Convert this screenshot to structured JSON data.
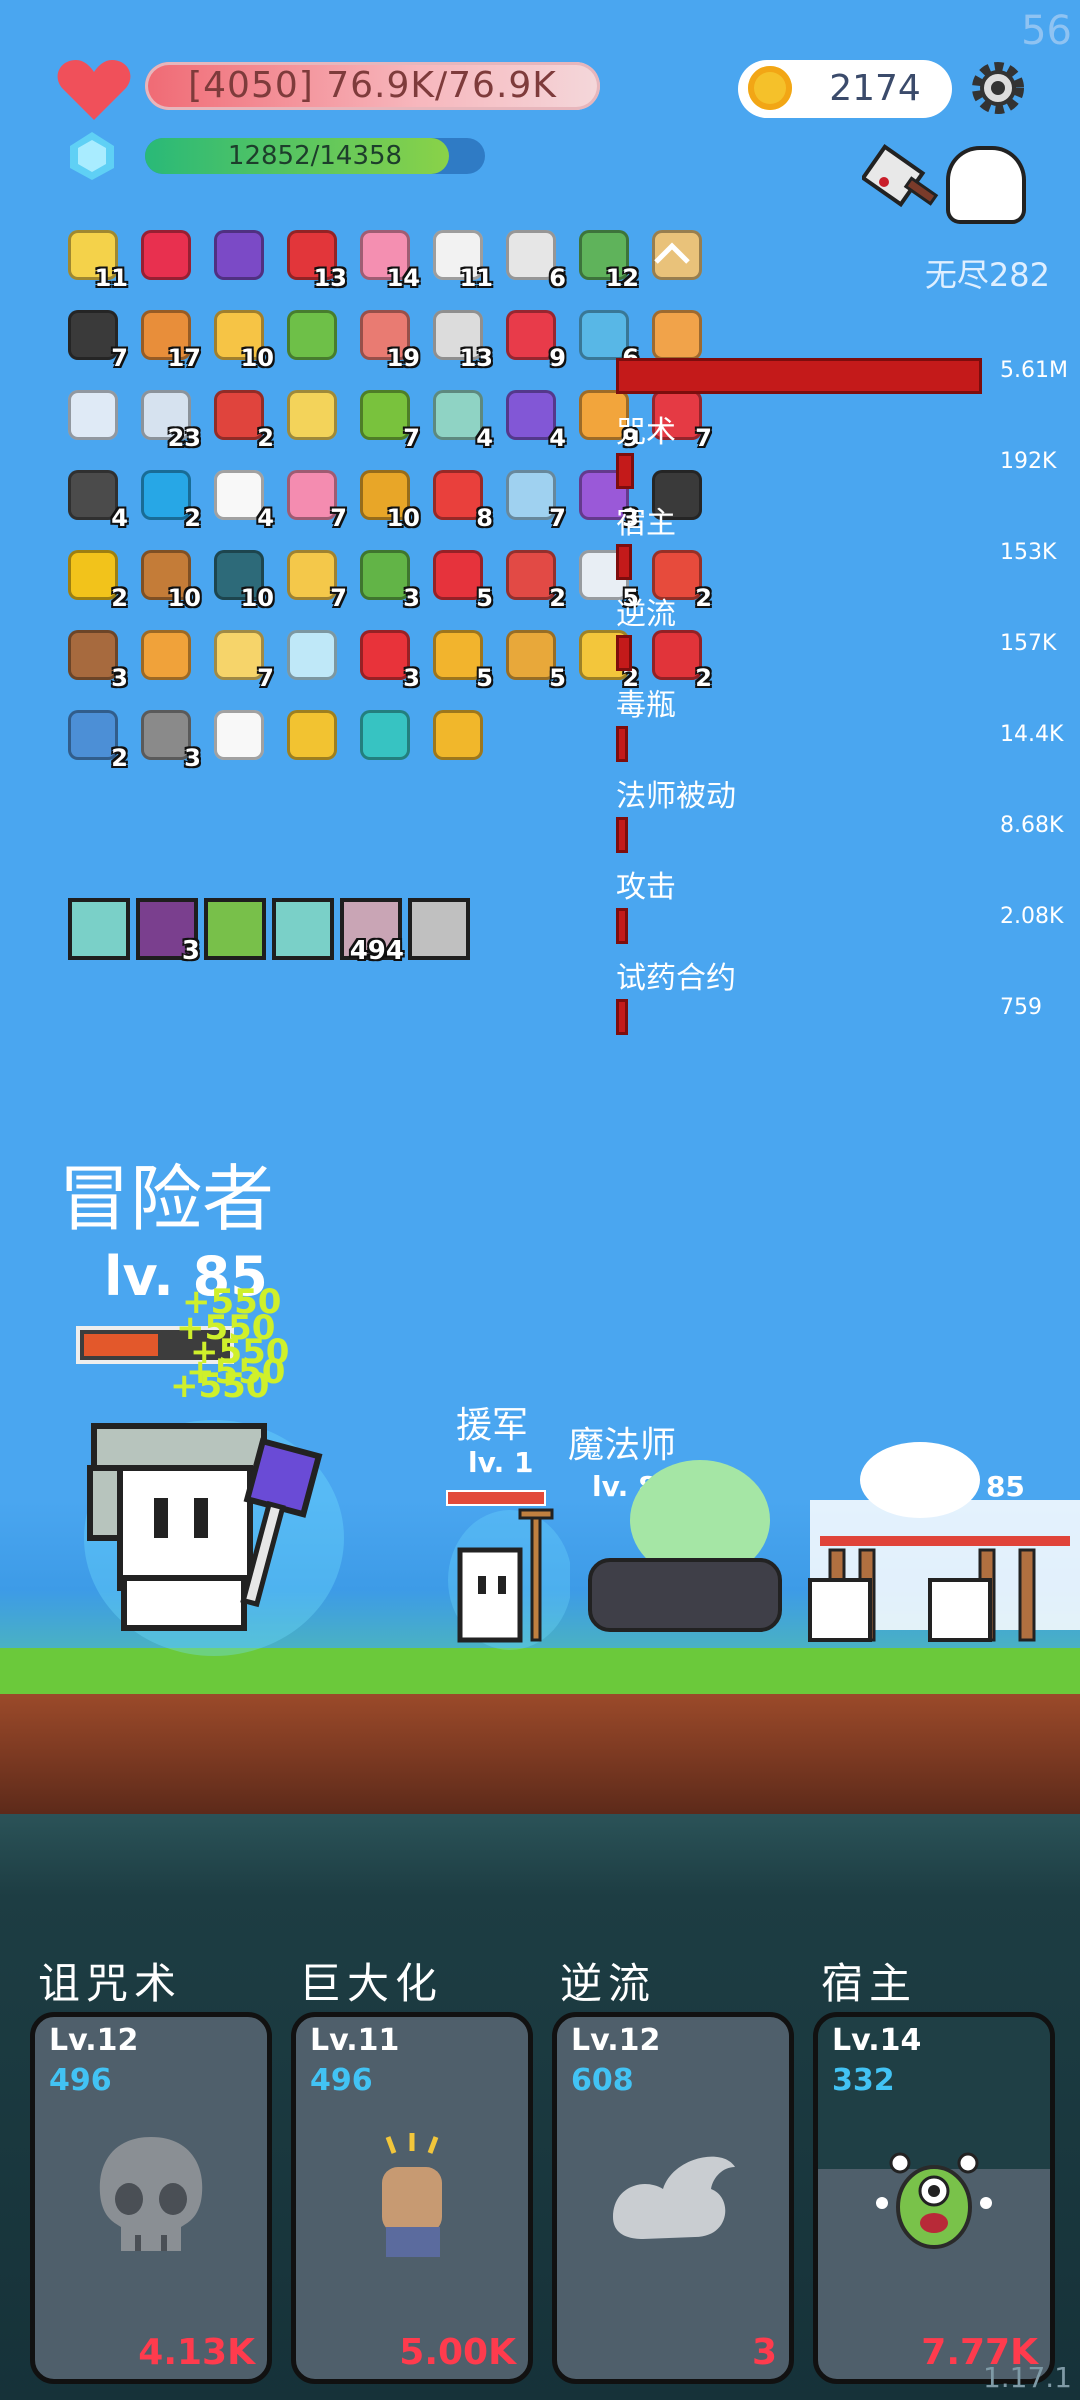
{
  "hud": {
    "fps": "56",
    "hp_text": "[4050] 76.9K/76.9K",
    "xp_text": "12852/14358",
    "xp_fraction": 0.8951,
    "coins": "2174",
    "endless_label": "无尽282"
  },
  "items": [
    {
      "icon": "star-card-icon",
      "color": "#f4d24a",
      "count": "11"
    },
    {
      "icon": "ruby-icon",
      "color": "#e8304f",
      "count": ""
    },
    {
      "icon": "wizard-hat-icon",
      "color": "#7b4ac6",
      "count": ""
    },
    {
      "icon": "mushroom-icon",
      "color": "#e2363a",
      "count": "13"
    },
    {
      "icon": "ice-cream-icon",
      "color": "#f48fb1",
      "count": "14"
    },
    {
      "icon": "cloud-icon",
      "color": "#f2f2f2",
      "count": "11"
    },
    {
      "icon": "envelope-icon",
      "color": "#e6e6e6",
      "count": "6"
    },
    {
      "icon": "cash-heart-icon",
      "color": "#5fb35b",
      "count": "12"
    },
    {
      "icon": "scroll-icon",
      "color": "#e9c27a",
      "count": ""
    },
    {
      "icon": "cauldron-icon",
      "color": "#3a3a3a",
      "count": "7"
    },
    {
      "icon": "briefcase-icon",
      "color": "#e88e3a",
      "count": "17"
    },
    {
      "icon": "lightbulb-icon",
      "color": "#f6c445",
      "count": "10"
    },
    {
      "icon": "green-book-icon",
      "color": "#6ec048",
      "count": ""
    },
    {
      "icon": "steak-icon",
      "color": "#e97b72",
      "count": "19"
    },
    {
      "icon": "hook-icon",
      "color": "#dcdcdc",
      "count": "13"
    },
    {
      "icon": "heart-icon",
      "color": "#e83b4a",
      "count": "9"
    },
    {
      "icon": "potion-flask-icon",
      "color": "#58b7e6",
      "count": "6"
    },
    {
      "icon": "map-icon",
      "color": "#f1a34a",
      "count": ""
    },
    {
      "icon": "wind-icon",
      "color": "#dfeaf6",
      "count": ""
    },
    {
      "icon": "bubbles-icon",
      "color": "#d6e2ef",
      "count": "23"
    },
    {
      "icon": "broken-heart-icon",
      "color": "#e0443d",
      "count": "2"
    },
    {
      "icon": "moon-cookie-icon",
      "color": "#f3d35a",
      "count": ""
    },
    {
      "icon": "lime-icon",
      "color": "#79c23d",
      "count": "7"
    },
    {
      "icon": "target-disc-icon",
      "color": "#8fd3c4",
      "count": "4"
    },
    {
      "icon": "crown-box-icon",
      "color": "#8257d6",
      "count": "4"
    },
    {
      "icon": "parchment-icon",
      "color": "#f2a53c",
      "count": "9"
    },
    {
      "icon": "strawberry-icon",
      "color": "#e53a44",
      "count": "7"
    },
    {
      "icon": "skull-book-icon",
      "color": "#4b4b4b",
      "count": "4"
    },
    {
      "icon": "sapphire-icon",
      "color": "#27a7e6",
      "count": "2"
    },
    {
      "icon": "ghost-icon",
      "color": "#f8f8f8",
      "count": "4"
    },
    {
      "icon": "perfume-icon",
      "color": "#f48cb0",
      "count": "7"
    },
    {
      "icon": "shell-icon",
      "color": "#e8a628",
      "count": "10"
    },
    {
      "icon": "sock-icon",
      "color": "#e9403c",
      "count": "8"
    },
    {
      "icon": "shirt-icon",
      "color": "#9fd1f0",
      "count": "7"
    },
    {
      "icon": "crystal-ball-icon",
      "color": "#9a59d8",
      "count": "3"
    },
    {
      "icon": "bat-icon",
      "color": "#3a3a3a",
      "count": ""
    },
    {
      "icon": "sunflower-icon",
      "color": "#f2c31b",
      "count": "2"
    },
    {
      "icon": "bow-icon",
      "color": "#c47c38",
      "count": "10"
    },
    {
      "icon": "chat-bubble-icon",
      "color": "#2d6a79",
      "count": "10"
    },
    {
      "icon": "cheese-icon",
      "color": "#f4c84a",
      "count": "7"
    },
    {
      "icon": "goblin-icon",
      "color": "#62b447",
      "count": "3"
    },
    {
      "icon": "bookmark-icon",
      "color": "#e6333c",
      "count": "5"
    },
    {
      "icon": "shield-red-icon",
      "color": "#e24a45",
      "count": "2"
    },
    {
      "icon": "clipboard-icon",
      "color": "#e8eef4",
      "count": "5"
    },
    {
      "icon": "gift-icon",
      "color": "#e74b3c",
      "count": "2"
    },
    {
      "icon": "dessert-icon",
      "color": "#a76a3e",
      "count": "3"
    },
    {
      "icon": "meteor-icon",
      "color": "#f0a23a",
      "count": ""
    },
    {
      "icon": "note-pencil-icon",
      "color": "#f6d46a",
      "count": "7"
    },
    {
      "icon": "halo-icon",
      "color": "#bfe8f8",
      "count": ""
    },
    {
      "icon": "percent-card-icon",
      "color": "#e8333a",
      "count": "3"
    },
    {
      "icon": "pineapple-icon",
      "color": "#f2b42d",
      "count": "5"
    },
    {
      "icon": "tome-icon",
      "color": "#e8a83a",
      "count": "5"
    },
    {
      "icon": "magic-wand-icon",
      "color": "#f3c63b",
      "count": "2"
    },
    {
      "icon": "bullseye-icon",
      "color": "#e1343a",
      "count": "2"
    },
    {
      "icon": "blue-shield-icon",
      "color": "#4c8fd6",
      "count": "2"
    },
    {
      "icon": "spiked-ball-icon",
      "color": "#8a8a8a",
      "count": "3"
    },
    {
      "icon": "speech-bubble-icon",
      "color": "#f8f8f8",
      "count": ""
    },
    {
      "icon": "ring-icon",
      "color": "#f2c331",
      "count": ""
    },
    {
      "icon": "spiral-icon",
      "color": "#37c3c2",
      "count": ""
    },
    {
      "icon": "coin-stack-icon",
      "color": "#f1b72b",
      "count": ""
    }
  ],
  "skill_slots": [
    {
      "icon": "light-gem-slot-icon",
      "color": "#7ad0c8",
      "count": ""
    },
    {
      "icon": "demon-slot-icon",
      "color": "#7a3f8e",
      "count": "3"
    },
    {
      "icon": "leaf-slot-icon",
      "color": "#78c04a",
      "count": ""
    },
    {
      "icon": "light-gem-slot-icon",
      "color": "#7ad0c8",
      "count": ""
    },
    {
      "icon": "sword-slot-icon",
      "color": "#c9a5b5",
      "count": "494"
    },
    {
      "icon": "shield-slot-icon",
      "color": "#c0c0c0",
      "count": ""
    }
  ],
  "damage_stats": [
    {
      "label": "",
      "value": "5.61M",
      "fraction": 1.0
    },
    {
      "label": "咒术",
      "value": "192K",
      "fraction": 0.034
    },
    {
      "label": "宿主",
      "value": "153K",
      "fraction": 0.027
    },
    {
      "label": "逆流",
      "value": "157K",
      "fraction": 0.028
    },
    {
      "label": "毒瓶",
      "value": "14.4K",
      "fraction": 0.003
    },
    {
      "label": "法师被动",
      "value": "8.68K",
      "fraction": 0.0015
    },
    {
      "label": "攻击",
      "value": "2.08K",
      "fraction": 0.0004
    },
    {
      "label": "试药合约",
      "value": "759",
      "fraction": 0.0001
    }
  ],
  "battle": {
    "player_name": "冒险者",
    "player_level": "lv. 85",
    "player_hp_fraction": 0.55,
    "floating_texts": [
      "+550",
      "+550",
      "+550",
      "+550",
      "+550"
    ],
    "ally_name": "援军",
    "ally_level": "lv. 1",
    "enemy_names_overlap": "魔法师",
    "enemy_level": "lv. 85",
    "enemy_level_2": "lv. 85"
  },
  "skills": [
    {
      "name": "诅咒术",
      "level": "Lv.12",
      "cost": "496",
      "damage": "4.13K",
      "art": "skull-icon"
    },
    {
      "name": "巨大化",
      "level": "Lv.11",
      "cost": "496",
      "damage": "5.00K",
      "art": "fist-icon"
    },
    {
      "name": "逆流",
      "level": "Lv.12",
      "cost": "608",
      "damage": "3",
      "art": "cloud-wave-icon"
    },
    {
      "name": "宿主",
      "level": "Lv.14",
      "cost": "332",
      "damage": "7.77K",
      "art": "alien-monster-icon"
    }
  ],
  "version": "1.17.1"
}
